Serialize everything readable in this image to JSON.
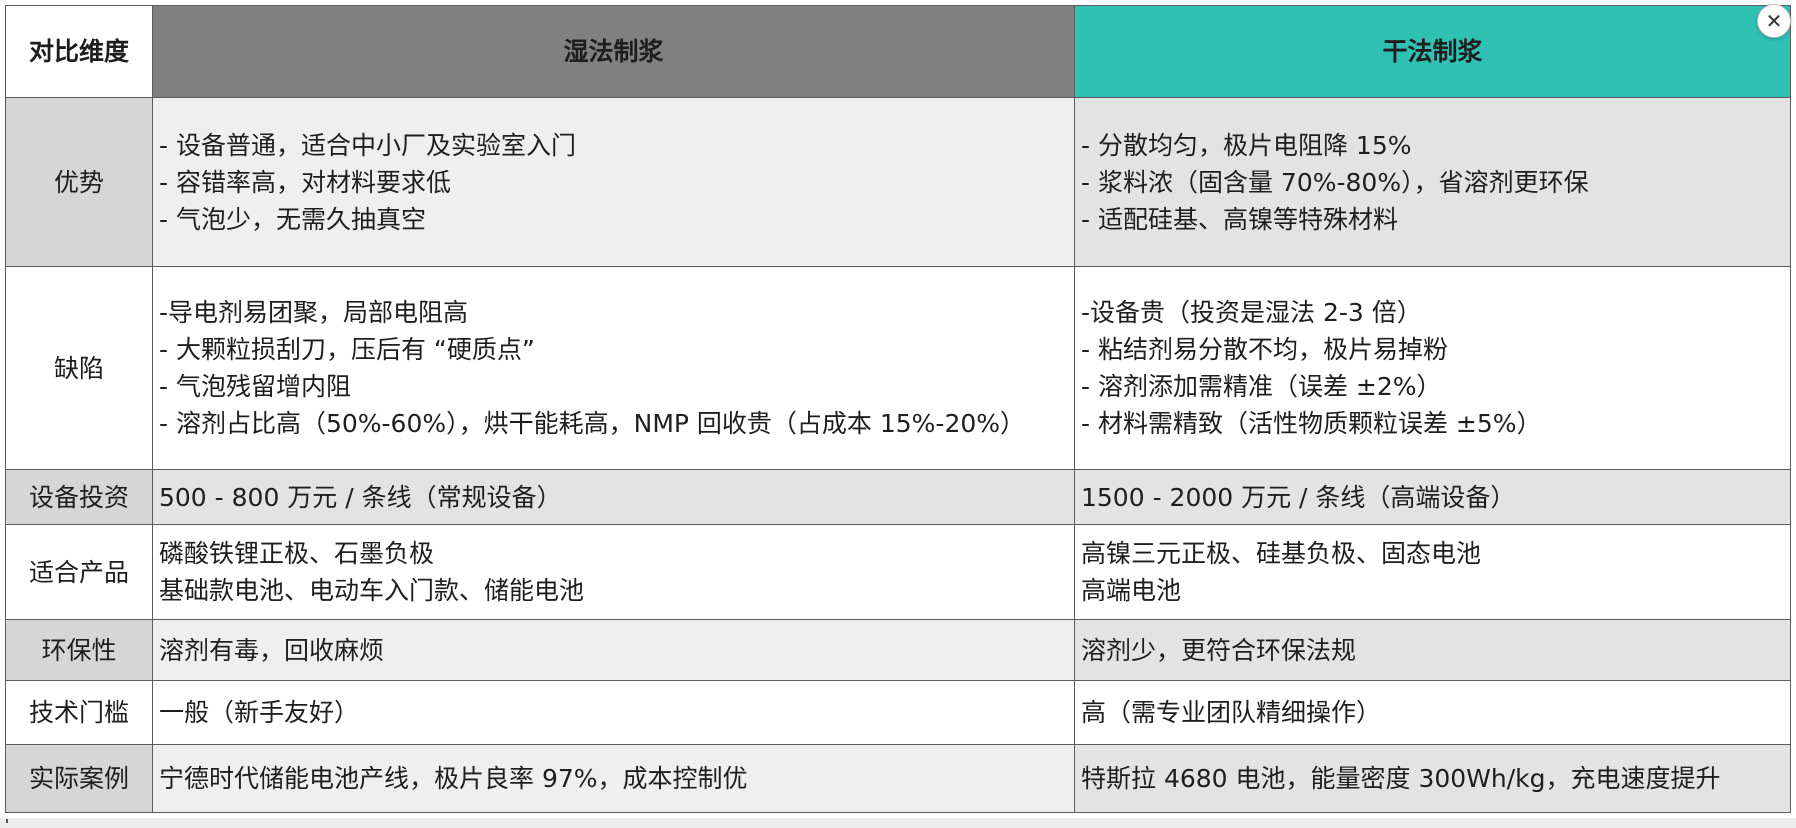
{
  "headers": {
    "dimension": "对比维度",
    "wet": "湿法制浆",
    "dry": "干法制浆"
  },
  "rows": [
    {
      "label": "优势",
      "wet": [
        "- 设备普通，适合中小厂及实验室入门",
        "- 容错率高，对材料要求低",
        "- 气泡少，无需久抽真空"
      ],
      "dry": [
        "- 分散均匀，极片电阻降 15%",
        "- 浆料浓（固含量 70%-80%），省溶剂更环保",
        "- 适配硅基、高镍等特殊材料"
      ]
    },
    {
      "label": "缺陷",
      "wet": [
        "-导电剂易团聚，局部电阻高",
        "- 大颗粒损刮刀，压后有 “硬质点”",
        "- 气泡残留增内阻",
        "- 溶剂占比高（50%-60%），烘干能耗高，NMP 回收贵（占成本 15%-20%）"
      ],
      "dry": [
        "-设备贵（投资是湿法 2-3 倍）",
        "- 粘结剂易分散不均，极片易掉粉",
        "- 溶剂添加需精准（误差 ±2%）",
        "- 材料需精致（活性物质颗粒误差 ±5%）"
      ]
    },
    {
      "label": "设备投资",
      "wet": [
        "500 - 800 万元 / 条线（常规设备）"
      ],
      "dry": [
        "1500 - 2000 万元 / 条线（高端设备）"
      ]
    },
    {
      "label": "适合产品",
      "wet": [
        "磷酸铁锂正极、石墨负极",
        "基础款电池、电动车入门款、储能电池"
      ],
      "dry": [
        "高镍三元正极、硅基负极、固态电池",
        "高端电池"
      ]
    },
    {
      "label": "环保性",
      "wet": [
        "溶剂有毒，回收麻烦"
      ],
      "dry": [
        "溶剂少，更符合环保法规"
      ]
    },
    {
      "label": "技术门槛",
      "wet": [
        "一般（新手友好）"
      ],
      "dry": [
        "高（需专业团队精细操作）"
      ]
    },
    {
      "label": "实际案例",
      "wet": [
        "宁德时代储能电池产线，极片良率 97%，成本控制优"
      ],
      "dry": [
        "特斯拉 4680 电池，能量密度 300Wh/kg，充电速度提升"
      ]
    }
  ],
  "close_icon": "close-icon",
  "colors": {
    "wet_header": "#808080",
    "dry_header": "#2fc1b4"
  }
}
